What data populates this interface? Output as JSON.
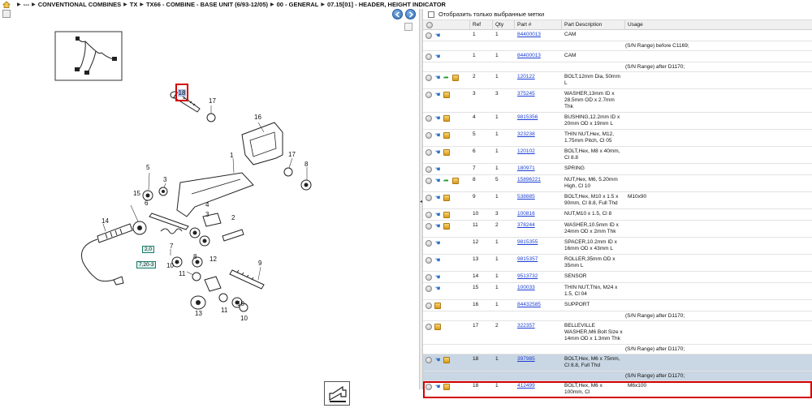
{
  "breadcrumb": {
    "items": [
      "---",
      "CONVENTIONAL COMBINES",
      "TX",
      "TX66 - COMBINE - BASE UNIT (6/93-12/05)",
      "00 - GENERAL",
      "07.15[01] - HEADER, HEIGHT INDICATOR"
    ]
  },
  "filter": {
    "label": "Отобразить только выбранные метки"
  },
  "table": {
    "headers": {
      "ref": "Ref",
      "qty": "Qty",
      "part": "Part #",
      "desc": "Part Description",
      "usage": "Usage"
    },
    "rows": [
      {
        "ref": "1",
        "qty": "1",
        "part": "84400013",
        "desc": "CAM",
        "usage": "",
        "note": "(S/N Range) before C1169;",
        "icons": [
          "search",
          "hand"
        ]
      },
      {
        "ref": "1",
        "qty": "1",
        "part": "84400013",
        "desc": "CAM",
        "usage": "",
        "note": "(S/N Range) after D1170;",
        "icons": [
          "search",
          "hand"
        ]
      },
      {
        "ref": "2",
        "qty": "1",
        "part": "120122",
        "desc": "BOLT,12mm Dia, 50mm L",
        "usage": "",
        "icons": [
          "search",
          "hand",
          "arrow",
          "box"
        ]
      },
      {
        "ref": "3",
        "qty": "3",
        "part": "375245",
        "desc": "WASHER,13mm ID x 28.5mm OD x 2.7mm Thk",
        "usage": "",
        "icons": [
          "search",
          "hand",
          "box"
        ]
      },
      {
        "ref": "4",
        "qty": "1",
        "part": "9815356",
        "desc": "BUSHING,12.2mm ID x 20mm OD x 19mm L",
        "usage": "",
        "icons": [
          "search",
          "hand",
          "box"
        ]
      },
      {
        "ref": "5",
        "qty": "1",
        "part": "323238",
        "desc": "THIN NUT,Hex, M12, 1.75mm Pitch, Cl 05",
        "usage": "",
        "icons": [
          "search",
          "hand",
          "box"
        ]
      },
      {
        "ref": "6",
        "qty": "1",
        "part": "120102",
        "desc": "BOLT,Hex, M8 x 40mm, Cl 8.8",
        "usage": "",
        "icons": [
          "search",
          "hand",
          "box"
        ]
      },
      {
        "ref": "7",
        "qty": "1",
        "part": "180971",
        "desc": "SPRING",
        "usage": "",
        "icons": [
          "search",
          "hand"
        ]
      },
      {
        "ref": "8",
        "qty": "5",
        "part": "15896221",
        "desc": "NUT,Hex, M6, 5.20mm High, Cl 10",
        "usage": "",
        "icons": [
          "search",
          "hand",
          "arrow",
          "box"
        ]
      },
      {
        "ref": "9",
        "qty": "1",
        "part": "538885",
        "desc": "BOLT,Hex, M10 x 1.5 x 90mm, Cl 8.8, Full Thd",
        "usage": "M10x90",
        "icons": [
          "search",
          "hand",
          "box"
        ]
      },
      {
        "ref": "10",
        "qty": "3",
        "part": "100816",
        "desc": "NUT,M10 x 1.5, Cl 8",
        "usage": "",
        "icons": [
          "search",
          "hand",
          "box"
        ]
      },
      {
        "ref": "11",
        "qty": "2",
        "part": "378244",
        "desc": "WASHER,10.5mm ID x 24mm OD x 2mm Thk",
        "usage": "",
        "icons": [
          "search",
          "hand",
          "box"
        ]
      },
      {
        "ref": "12",
        "qty": "1",
        "part": "9815355",
        "desc": "SPACER,10.2mm ID x 16mm OD x 43mm L",
        "usage": "",
        "icons": [
          "search",
          "hand"
        ]
      },
      {
        "ref": "13",
        "qty": "1",
        "part": "9815357",
        "desc": "ROLLER,35mm OD x 35mm L",
        "usage": "",
        "icons": [
          "search",
          "hand"
        ]
      },
      {
        "ref": "14",
        "qty": "1",
        "part": "9513732",
        "desc": "SENSOR",
        "usage": "",
        "icons": [
          "search",
          "hand"
        ]
      },
      {
        "ref": "15",
        "qty": "1",
        "part": "100033",
        "desc": "THIN NUT,Thin, M24 x 1.5, Cl 04",
        "usage": "",
        "icons": [
          "search",
          "hand"
        ]
      },
      {
        "ref": "16",
        "qty": "1",
        "part": "84432585",
        "desc": "SUPPORT",
        "usage": "",
        "note": "(S/N Range) after D1170;",
        "icons": [
          "search",
          "box"
        ]
      },
      {
        "ref": "17",
        "qty": "2",
        "part": "322357",
        "desc": "BELLEVILLE WASHER,M6 Bolt Size x 14mm OD x 1.3mm Thk",
        "usage": "",
        "note": "(S/N Range) after D1170;",
        "icons": [
          "search",
          "box"
        ]
      },
      {
        "ref": "18",
        "qty": "1",
        "part": "397985",
        "desc": "BOLT,Hex, M6 x 75mm, Cl 8.8, Full Thd",
        "usage": "",
        "note": "(S/N Range) after D1170;",
        "shaded": true,
        "icons": [
          "search",
          "hand",
          "box"
        ]
      },
      {
        "ref": "18",
        "qty": "1",
        "part": "412499",
        "desc": "BOLT,Hex, M6 x 100mm, Cl",
        "usage": "M6x100",
        "selected": true,
        "icons": [
          "search",
          "hand",
          "box"
        ]
      }
    ]
  },
  "diagram": {
    "highlight_label": "18",
    "tag_a": "2,0",
    "tag_b": "7,20-3",
    "callouts": [
      "1",
      "2",
      "3",
      "3",
      "4",
      "5",
      "6",
      "7",
      "8",
      "8",
      "9",
      "10",
      "10",
      "10",
      "11",
      "11",
      "12",
      "13",
      "14",
      "15",
      "16",
      "17",
      "17"
    ]
  },
  "colors": {
    "accent": "#d40000",
    "link": "#1a3fd4",
    "shaded_row": "#c9d6e3"
  }
}
